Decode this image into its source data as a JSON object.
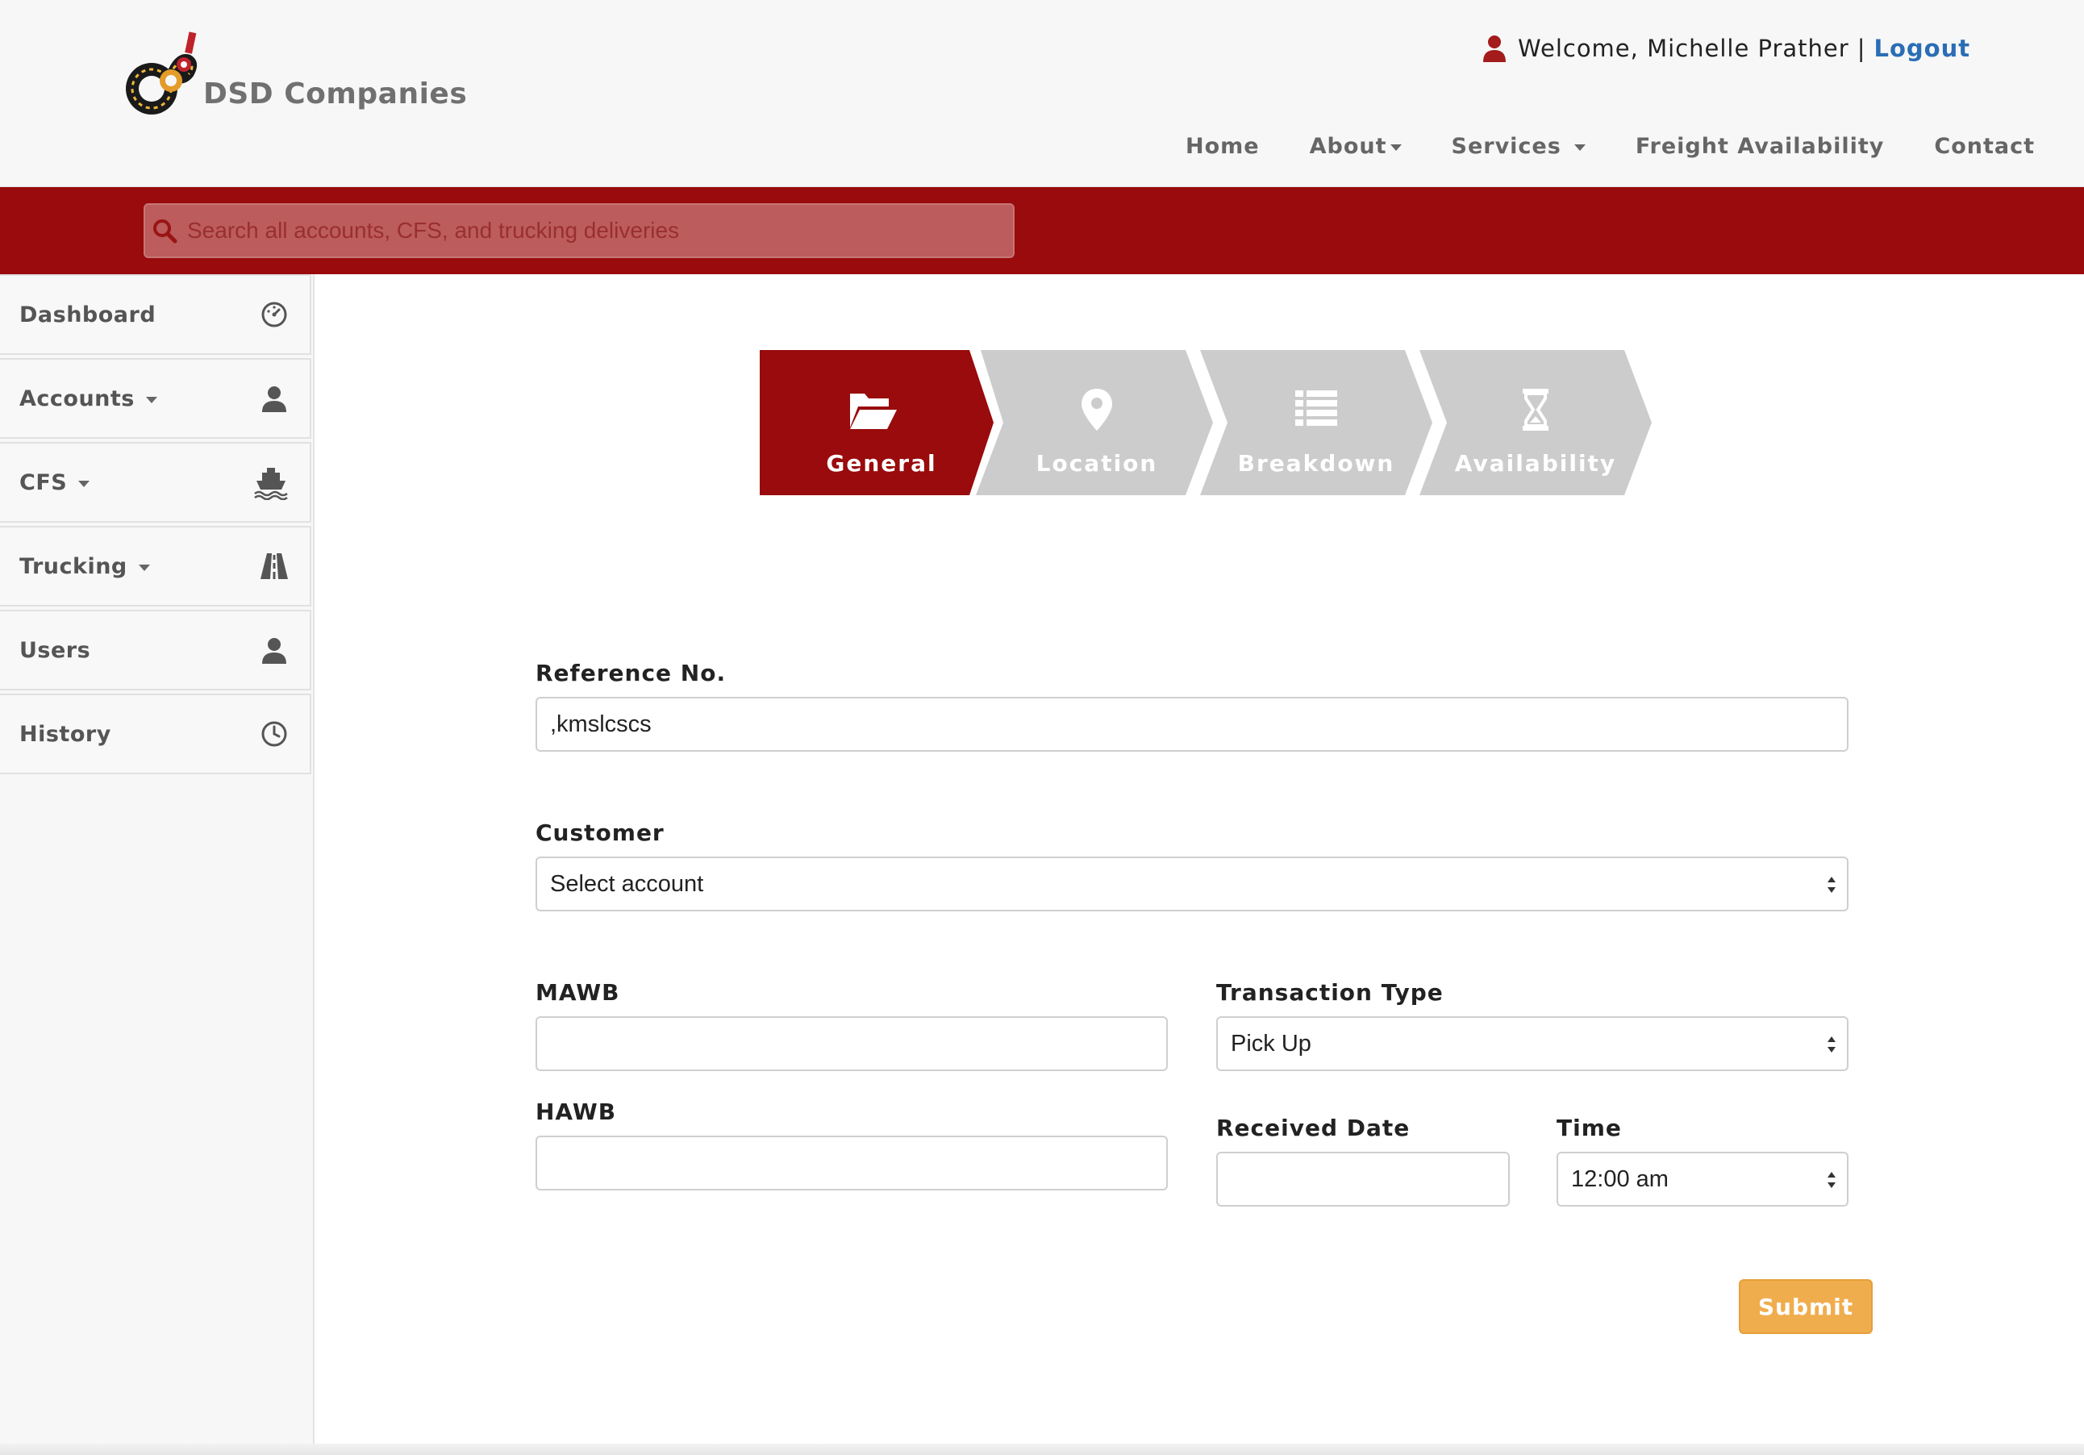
{
  "header": {
    "brand": "DSD Companies",
    "welcome_text": "Welcome, Michelle Prather",
    "separator": "|",
    "logout_label": "Logout",
    "nav": [
      {
        "label": "Home",
        "has_caret": false
      },
      {
        "label": "About",
        "has_caret": true
      },
      {
        "label": "Services",
        "has_caret": true
      },
      {
        "label": "Freight Availability",
        "has_caret": false
      },
      {
        "label": "Contact",
        "has_caret": false
      }
    ]
  },
  "search": {
    "placeholder": "Search all accounts, CFS, and trucking deliveries",
    "icon": "search-icon"
  },
  "sidebar": {
    "items": [
      {
        "label": "Dashboard",
        "icon": "dashboard-icon",
        "has_caret": false
      },
      {
        "label": "Accounts",
        "icon": "user-icon",
        "has_caret": true
      },
      {
        "label": "CFS",
        "icon": "ship-icon",
        "has_caret": true
      },
      {
        "label": "Trucking",
        "icon": "road-icon",
        "has_caret": true
      },
      {
        "label": "Users",
        "icon": "user-icon",
        "has_caret": false
      },
      {
        "label": "History",
        "icon": "clock-icon",
        "has_caret": false
      }
    ]
  },
  "wizard": {
    "steps": [
      {
        "label": "General",
        "icon": "folder-open-icon",
        "active": true
      },
      {
        "label": "Location",
        "icon": "map-marker-icon",
        "active": false
      },
      {
        "label": "Breakdown",
        "icon": "list-icon",
        "active": false
      },
      {
        "label": "Availability",
        "icon": "hourglass-icon",
        "active": false
      }
    ]
  },
  "form": {
    "reference_label": "Reference No.",
    "reference_value": ",kmslcscs",
    "customer_label": "Customer",
    "customer_value": "Select account",
    "mawb_label": "MAWB",
    "mawb_value": "",
    "hawb_label": "HAWB",
    "hawb_value": "",
    "transaction_label": "Transaction Type",
    "transaction_value": "Pick Up",
    "received_label": "Received Date",
    "received_value": "",
    "time_label": "Time",
    "time_value": "12:00 am",
    "submit_label": "Submit"
  },
  "colors": {
    "brand_red": "#990b0c",
    "step_inactive": "#cccccc",
    "submit_orange": "#f0ad4e",
    "logout_blue": "#2a6db5"
  }
}
